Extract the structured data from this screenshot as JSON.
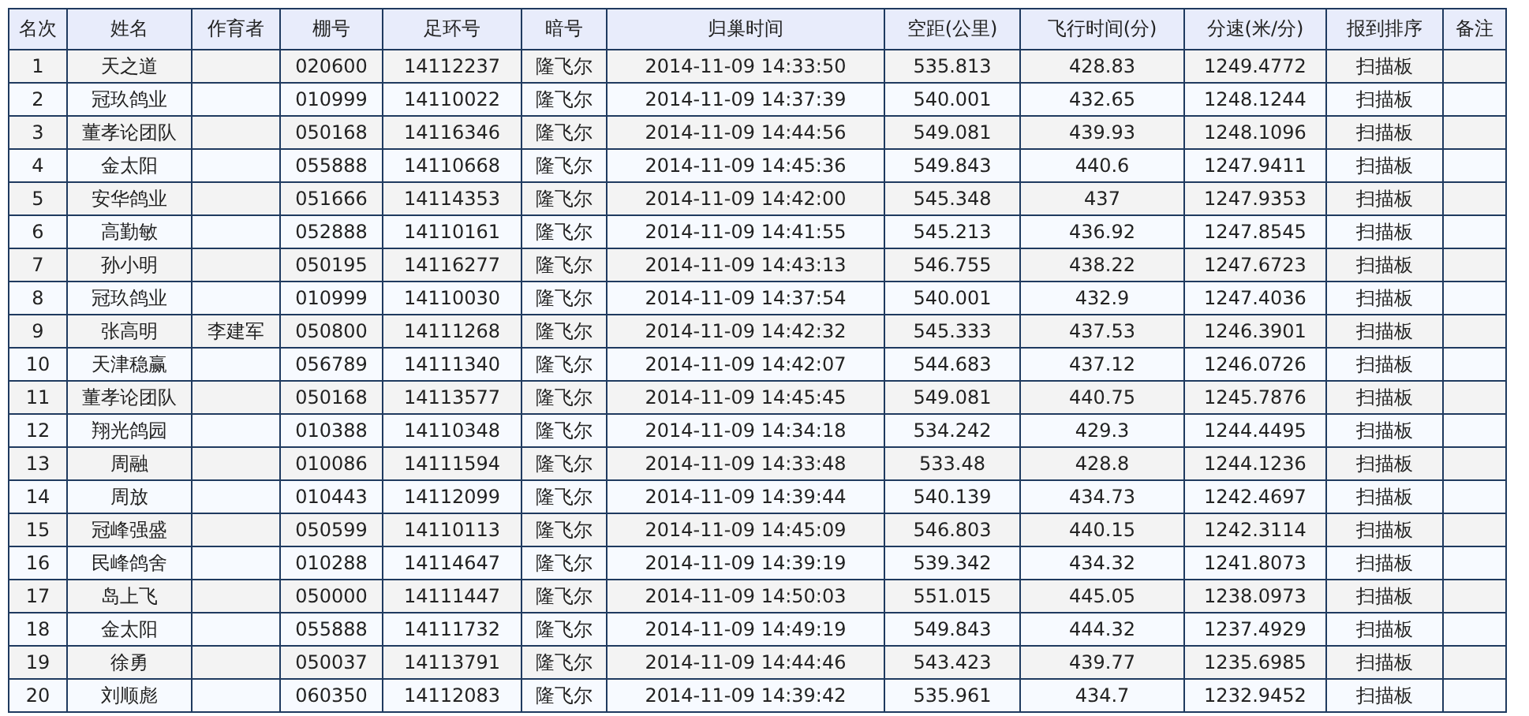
{
  "table": {
    "columns": [
      "名次",
      "姓名",
      "作育者",
      "棚号",
      "足环号",
      "暗号",
      "归巢时间",
      "空距(公里)",
      "飞行时间(分)",
      "分速(米/分)",
      "报到排序",
      "备注"
    ],
    "rows": [
      [
        "1",
        "天之道",
        "",
        "020600",
        "14112237",
        "隆飞尔",
        "2014-11-09 14:33:50",
        "535.813",
        "428.83",
        "1249.4772",
        "扫描板",
        ""
      ],
      [
        "2",
        "冠玖鸽业",
        "",
        "010999",
        "14110022",
        "隆飞尔",
        "2014-11-09 14:37:39",
        "540.001",
        "432.65",
        "1248.1244",
        "扫描板",
        ""
      ],
      [
        "3",
        "董孝论团队",
        "",
        "050168",
        "14116346",
        "隆飞尔",
        "2014-11-09 14:44:56",
        "549.081",
        "439.93",
        "1248.1096",
        "扫描板",
        ""
      ],
      [
        "4",
        "金太阳",
        "",
        "055888",
        "14110668",
        "隆飞尔",
        "2014-11-09 14:45:36",
        "549.843",
        "440.6",
        "1247.9411",
        "扫描板",
        ""
      ],
      [
        "5",
        "安华鸽业",
        "",
        "051666",
        "14114353",
        "隆飞尔",
        "2014-11-09 14:42:00",
        "545.348",
        "437",
        "1247.9353",
        "扫描板",
        ""
      ],
      [
        "6",
        "高勤敏",
        "",
        "052888",
        "14110161",
        "隆飞尔",
        "2014-11-09 14:41:55",
        "545.213",
        "436.92",
        "1247.8545",
        "扫描板",
        ""
      ],
      [
        "7",
        "孙小明",
        "",
        "050195",
        "14116277",
        "隆飞尔",
        "2014-11-09 14:43:13",
        "546.755",
        "438.22",
        "1247.6723",
        "扫描板",
        ""
      ],
      [
        "8",
        "冠玖鸽业",
        "",
        "010999",
        "14110030",
        "隆飞尔",
        "2014-11-09 14:37:54",
        "540.001",
        "432.9",
        "1247.4036",
        "扫描板",
        ""
      ],
      [
        "9",
        "张高明",
        "李建军",
        "050800",
        "14111268",
        "隆飞尔",
        "2014-11-09 14:42:32",
        "545.333",
        "437.53",
        "1246.3901",
        "扫描板",
        ""
      ],
      [
        "10",
        "天津稳赢",
        "",
        "056789",
        "14111340",
        "隆飞尔",
        "2014-11-09 14:42:07",
        "544.683",
        "437.12",
        "1246.0726",
        "扫描板",
        ""
      ],
      [
        "11",
        "董孝论团队",
        "",
        "050168",
        "14113577",
        "隆飞尔",
        "2014-11-09 14:45:45",
        "549.081",
        "440.75",
        "1245.7876",
        "扫描板",
        ""
      ],
      [
        "12",
        "翔光鸽园",
        "",
        "010388",
        "14110348",
        "隆飞尔",
        "2014-11-09 14:34:18",
        "534.242",
        "429.3",
        "1244.4495",
        "扫描板",
        ""
      ],
      [
        "13",
        "周融",
        "",
        "010086",
        "14111594",
        "隆飞尔",
        "2014-11-09 14:33:48",
        "533.48",
        "428.8",
        "1244.1236",
        "扫描板",
        ""
      ],
      [
        "14",
        "周放",
        "",
        "010443",
        "14112099",
        "隆飞尔",
        "2014-11-09 14:39:44",
        "540.139",
        "434.73",
        "1242.4697",
        "扫描板",
        ""
      ],
      [
        "15",
        "冠峰强盛",
        "",
        "050599",
        "14110113",
        "隆飞尔",
        "2014-11-09 14:45:09",
        "546.803",
        "440.15",
        "1242.3114",
        "扫描板",
        ""
      ],
      [
        "16",
        "民峰鸽舍",
        "",
        "010288",
        "14114647",
        "隆飞尔",
        "2014-11-09 14:39:19",
        "539.342",
        "434.32",
        "1241.8073",
        "扫描板",
        ""
      ],
      [
        "17",
        "岛上飞",
        "",
        "050000",
        "14111447",
        "隆飞尔",
        "2014-11-09 14:50:03",
        "551.015",
        "445.05",
        "1238.0973",
        "扫描板",
        ""
      ],
      [
        "18",
        "金太阳",
        "",
        "055888",
        "14111732",
        "隆飞尔",
        "2014-11-09 14:49:19",
        "549.843",
        "444.32",
        "1237.4929",
        "扫描板",
        ""
      ],
      [
        "19",
        "徐勇",
        "",
        "050037",
        "14113791",
        "隆飞尔",
        "2014-11-09 14:44:46",
        "543.423",
        "439.77",
        "1235.6985",
        "扫描板",
        ""
      ],
      [
        "20",
        "刘顺彪",
        "",
        "060350",
        "14112083",
        "隆飞尔",
        "2014-11-09 14:39:42",
        "535.961",
        "434.7",
        "1232.9452",
        "扫描板",
        ""
      ]
    ]
  }
}
